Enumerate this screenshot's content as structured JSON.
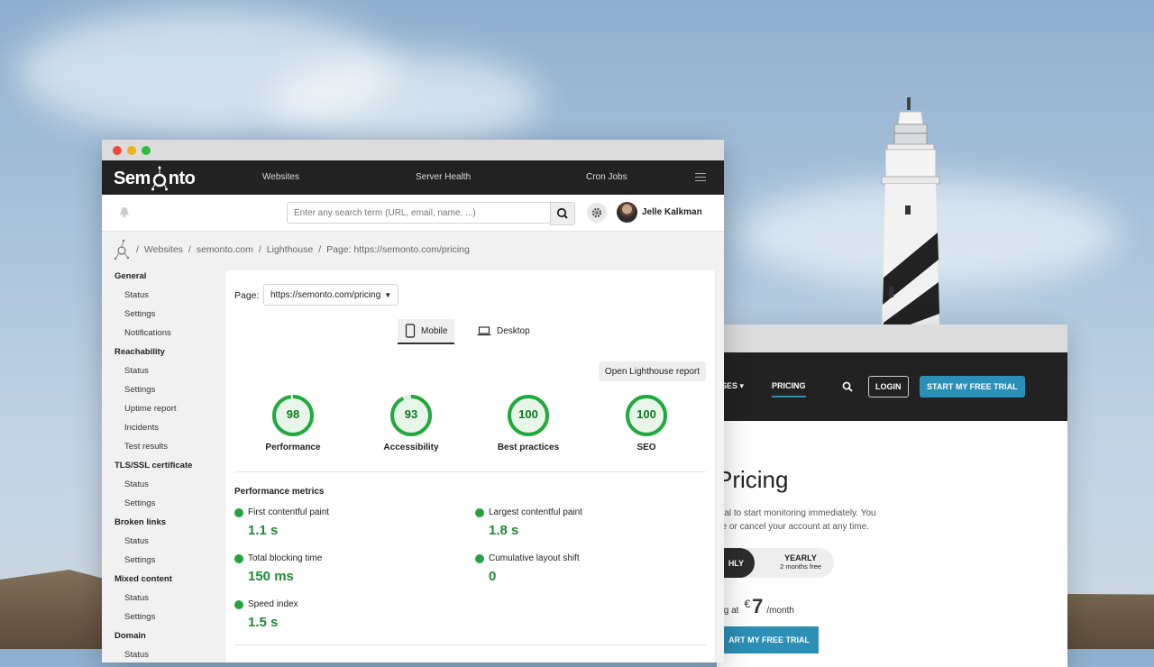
{
  "main_window": {
    "brand": {
      "prefix": "Sem",
      "suffix": "nto"
    },
    "nav": {
      "websites": "Websites",
      "server_health": "Server Health",
      "cron_jobs": "Cron Jobs"
    },
    "search": {
      "placeholder": "Enter any search term (URL, email, name, ...)"
    },
    "user": {
      "name": "Jelle Kalkman"
    },
    "breadcrumb": [
      "Websites",
      "semonto.com",
      "Lighthouse",
      "Page: https://semonto.com/pricing"
    ],
    "sidebar": [
      {
        "heading": "General",
        "items": [
          "Status",
          "Settings",
          "Notifications"
        ]
      },
      {
        "heading": "Reachability",
        "items": [
          "Status",
          "Settings",
          "Uptime report",
          "Incidents",
          "Test results"
        ]
      },
      {
        "heading": "TLS/SSL certificate",
        "items": [
          "Status",
          "Settings"
        ]
      },
      {
        "heading": "Broken links",
        "items": [
          "Status",
          "Settings"
        ]
      },
      {
        "heading": "Mixed content",
        "items": [
          "Status",
          "Settings"
        ]
      },
      {
        "heading": "Domain",
        "items": [
          "Status"
        ]
      }
    ],
    "page_selector": {
      "label": "Page:",
      "value": "https://semonto.com/pricing"
    },
    "device_tabs": {
      "mobile": "Mobile",
      "desktop": "Desktop",
      "selected": "Mobile"
    },
    "report_button": "Open Lighthouse report",
    "scores": [
      {
        "label": "Performance",
        "value": 98
      },
      {
        "label": "Accessibility",
        "value": 93
      },
      {
        "label": "Best practices",
        "value": 100
      },
      {
        "label": "SEO",
        "value": 100
      }
    ],
    "metrics_title": "Performance metrics",
    "metrics": [
      {
        "label": "First contentful paint",
        "value": "1.1 s"
      },
      {
        "label": "Largest contentful paint",
        "value": "1.8 s"
      },
      {
        "label": "Total blocking time",
        "value": "150 ms"
      },
      {
        "label": "Cumulative layout shift",
        "value": "0"
      },
      {
        "label": "Speed index",
        "value": "1.5 s"
      }
    ],
    "colors": {
      "score_green": "#0a7a1c",
      "metric_dot": "#23a33e",
      "navbar": "#222222"
    }
  },
  "pricing_window": {
    "nav": {
      "partial_menu": "SES",
      "pricing": "PRICING",
      "login": "LOGIN",
      "trial": "START MY FREE TRIAL"
    },
    "title": "Pricing",
    "desc_line1": "trial to start monitoring immediately. You",
    "desc_line2": "de or cancel your account at any time.",
    "toggle": {
      "monthly": "HLY",
      "yearly": "YEARLY",
      "yearly_note": "2 months free"
    },
    "price": {
      "prefix": "ing at",
      "currency": "€",
      "amount": "7",
      "period": "/month"
    },
    "cta": "ART MY FREE TRIAL",
    "colors": {
      "accent": "#2b8fb6"
    }
  }
}
